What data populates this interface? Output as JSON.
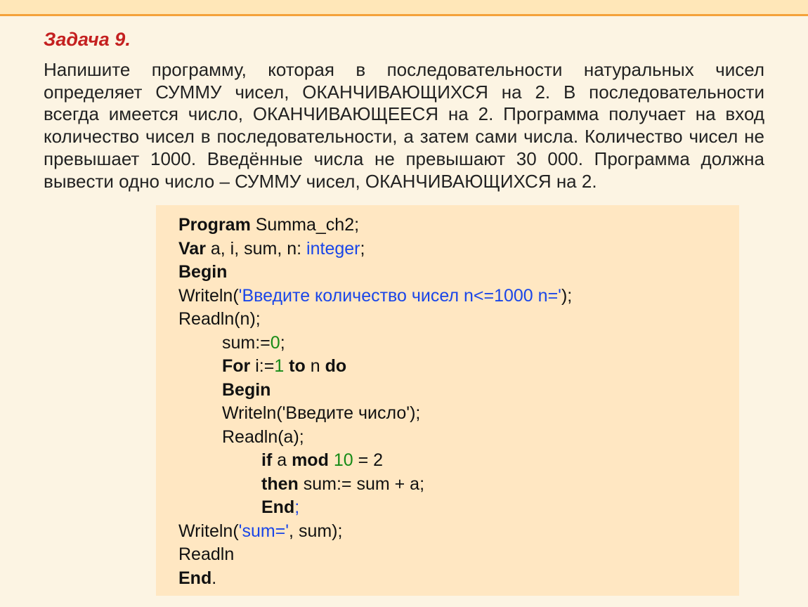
{
  "header": {
    "title": "Задача 9."
  },
  "task": {
    "text": "Напишите программу, которая в последовательности натуральных чисел определяет СУММУ чисел, ОКАНЧИВАЮЩИХСЯ на 2. В последовательности всегда имеется число, ОКАНЧИВАЮЩЕЕСЯ на 2. Программа получает на вход количество чисел в последовательности, а затем сами числа. Количество чисел не превышает 1000. Введённые числа не превышают 30 000. Программа должна вывести одно число – СУММУ чисел, ОКАНЧИВАЮЩИХСЯ на 2."
  },
  "code": {
    "l1_kw": "Program",
    "l1_rest": " Summa_ch2;",
    "l2_kw": "Var",
    "l2_mid": " a, i, sum, n: ",
    "l2_type": "integer",
    "l2_end": ";",
    "l3_kw": "Begin",
    "l4_pre": "Writeln(",
    "l4_str": "'Введите количество чисел n<=1000 n='",
    "l4_post": ");",
    "l5": "Readln(n);",
    "l6_pre": "sum:=",
    "l6_zero": "0",
    "l6_post": ";",
    "l7_for": "For",
    "l7_mid1": " i:=",
    "l7_one": "1",
    "l7_to": " to ",
    "l7_n": "n ",
    "l7_do": "do",
    "l8_kw": "Begin",
    "l9": "Writeln('Введите число');",
    "l10": "Readln(a);",
    "l11_if": "if",
    "l11_mid": " a ",
    "l11_mod": "mod",
    "l11_sp": " ",
    "l11_ten": "10",
    "l11_rest": " = 2",
    "l12_then": "then",
    "l12_rest": " sum:= sum + a;",
    "l13_end": "End",
    "l13_semi": ";",
    "l14_pre": "Writeln(",
    "l14_str": "'sum='",
    "l14_post": ", sum);",
    "l15": "Readln",
    "l16_end": "End",
    "l16_dot": "."
  }
}
